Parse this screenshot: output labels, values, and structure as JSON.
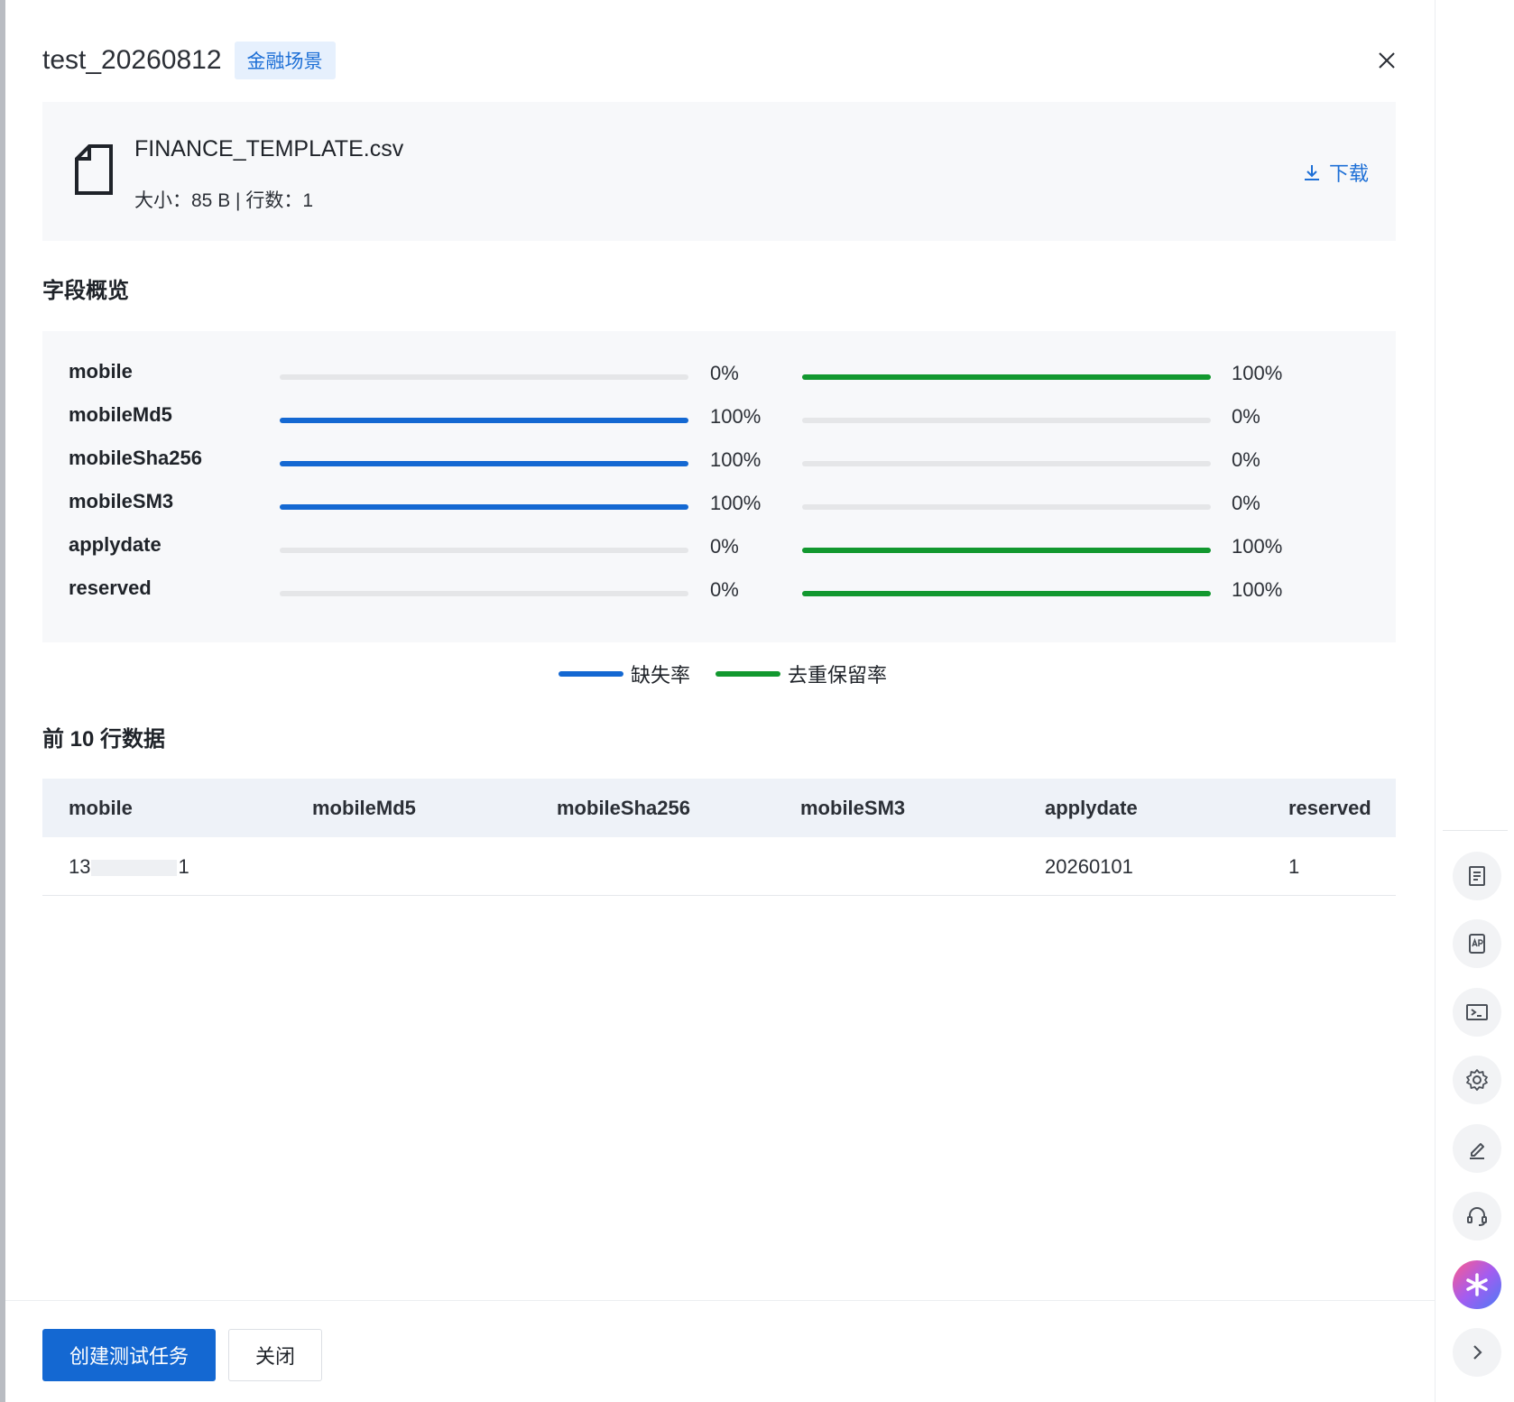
{
  "dialog": {
    "title": "test_20260812",
    "tag": "金融场景"
  },
  "file": {
    "name": "FINANCE_TEMPLATE.csv",
    "meta": "大小：85 B | 行数：1",
    "download_label": "下载"
  },
  "overview": {
    "title": "字段概览",
    "colors": {
      "missing": "#1468d2",
      "dedup": "#12982f",
      "track": "#e5e6e8"
    },
    "chart_data": {
      "type": "bar",
      "orientation": "horizontal",
      "categories": [
        "mobile",
        "mobileMd5",
        "mobileSha256",
        "mobileSM3",
        "applydate",
        "reserved"
      ],
      "series": [
        {
          "name": "缺失率",
          "values": [
            0,
            100,
            100,
            100,
            0,
            0
          ]
        },
        {
          "name": "去重保留率",
          "values": [
            100,
            0,
            0,
            0,
            100,
            100
          ]
        }
      ],
      "value_labels": {
        "missing": [
          "0%",
          "100%",
          "100%",
          "100%",
          "0%",
          "0%"
        ],
        "dedup": [
          "100%",
          "0%",
          "0%",
          "0%",
          "100%",
          "100%"
        ]
      },
      "xlim": [
        0,
        100
      ],
      "legend": "bottom-center"
    }
  },
  "preview": {
    "title": "前 10 行数据",
    "columns": [
      "mobile",
      "mobileMd5",
      "mobileSha256",
      "mobileSM3",
      "applydate",
      "reserved"
    ],
    "row": {
      "mobile_prefix": "13",
      "mobile_suffix": "1",
      "mobileMd5": "",
      "mobileSha256": "",
      "mobileSM3": "",
      "applydate": "20260101",
      "reserved": "1"
    }
  },
  "footer": {
    "primary_label": "创建测试任务",
    "close_label": "关闭"
  },
  "rail": {
    "buttons": [
      "document-icon",
      "app-icon",
      "terminal-icon",
      "gear-icon",
      "edit-icon",
      "headset-icon",
      "ai-assistant-icon",
      "chevron-right-icon"
    ]
  }
}
